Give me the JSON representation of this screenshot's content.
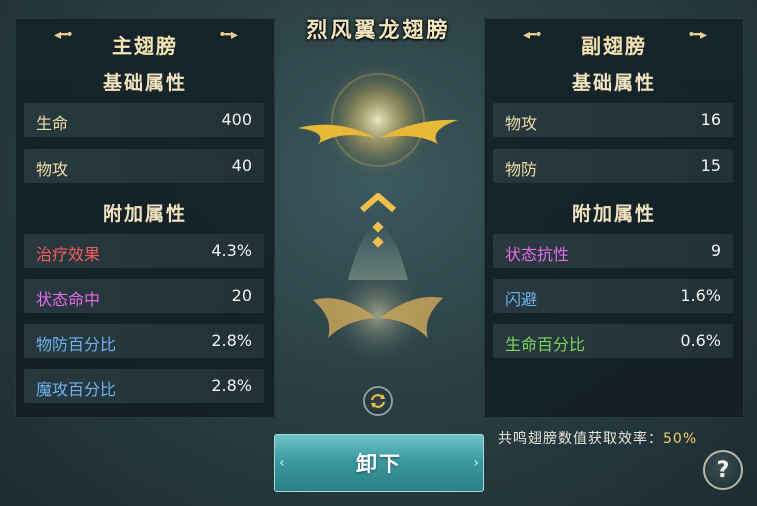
{
  "wing_name": "烈风翼龙翅膀",
  "colors": {
    "red": "#ff5b5b",
    "pink": "#e86be8",
    "blue": "#6fb3f0",
    "green": "#7fd65a",
    "gold": "#f0dea8"
  },
  "left_panel": {
    "title": "主翅膀",
    "basic_title": "基础属性",
    "basic": [
      {
        "name": "生命",
        "value": "400"
      },
      {
        "name": "物攻",
        "value": "40"
      }
    ],
    "extra_title": "附加属性",
    "extra": [
      {
        "name": "治疗效果",
        "value": "4.3%",
        "color": "#ff5b5b"
      },
      {
        "name": "状态命中",
        "value": "20",
        "color": "#e86be8"
      },
      {
        "name": "物防百分比",
        "value": "2.8%",
        "color": "#6fb3f0"
      },
      {
        "name": "魔攻百分比",
        "value": "2.8%",
        "color": "#6fb3f0"
      }
    ]
  },
  "right_panel": {
    "title": "副翅膀",
    "basic_title": "基础属性",
    "basic": [
      {
        "name": "物攻",
        "value": "16"
      },
      {
        "name": "物防",
        "value": "15"
      }
    ],
    "extra_title": "附加属性",
    "extra": [
      {
        "name": "状态抗性",
        "value": "9",
        "color": "#e86be8"
      },
      {
        "name": "闪避",
        "value": "1.6%",
        "color": "#6fb3f0"
      },
      {
        "name": "生命百分比",
        "value": "0.6%",
        "color": "#7fd65a"
      }
    ]
  },
  "unequip_label": "卸下",
  "resonance_label": "共鸣翅膀数值获取效率：",
  "resonance_value": "50%",
  "help_label": "?",
  "icons": {
    "swap": "swap-icon",
    "help": "question-icon",
    "up": "up-chevron-icon"
  }
}
